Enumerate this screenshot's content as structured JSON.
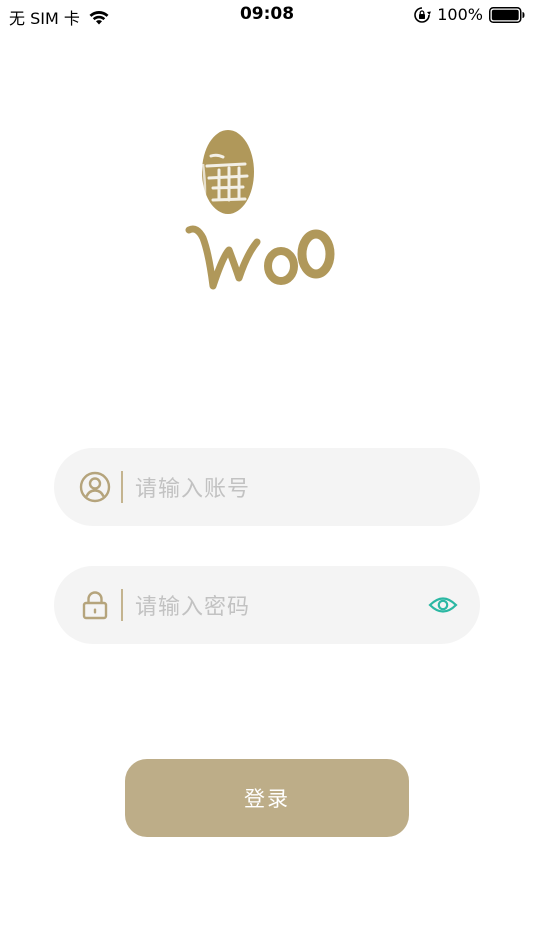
{
  "status_bar": {
    "carrier": "无 SIM 卡",
    "time": "09:08",
    "battery_percent": "100%",
    "icons": [
      "wifi-icon",
      "rotation-lock-icon",
      "battery-icon"
    ]
  },
  "logo": {
    "text": "Woo",
    "icon": "woo-logo"
  },
  "login_form": {
    "account_placeholder": "请输入账号",
    "password_placeholder": "请输入密码",
    "account_icon": "user-icon",
    "password_icon": "lock-icon",
    "visibility_icon": "eye-icon",
    "submit_label": "登录"
  },
  "colors": {
    "accent": "#bdad88",
    "field_background": "#f4f4f4",
    "placeholder": "#c2c2c2",
    "eye_icon": "#2bb8a3"
  }
}
